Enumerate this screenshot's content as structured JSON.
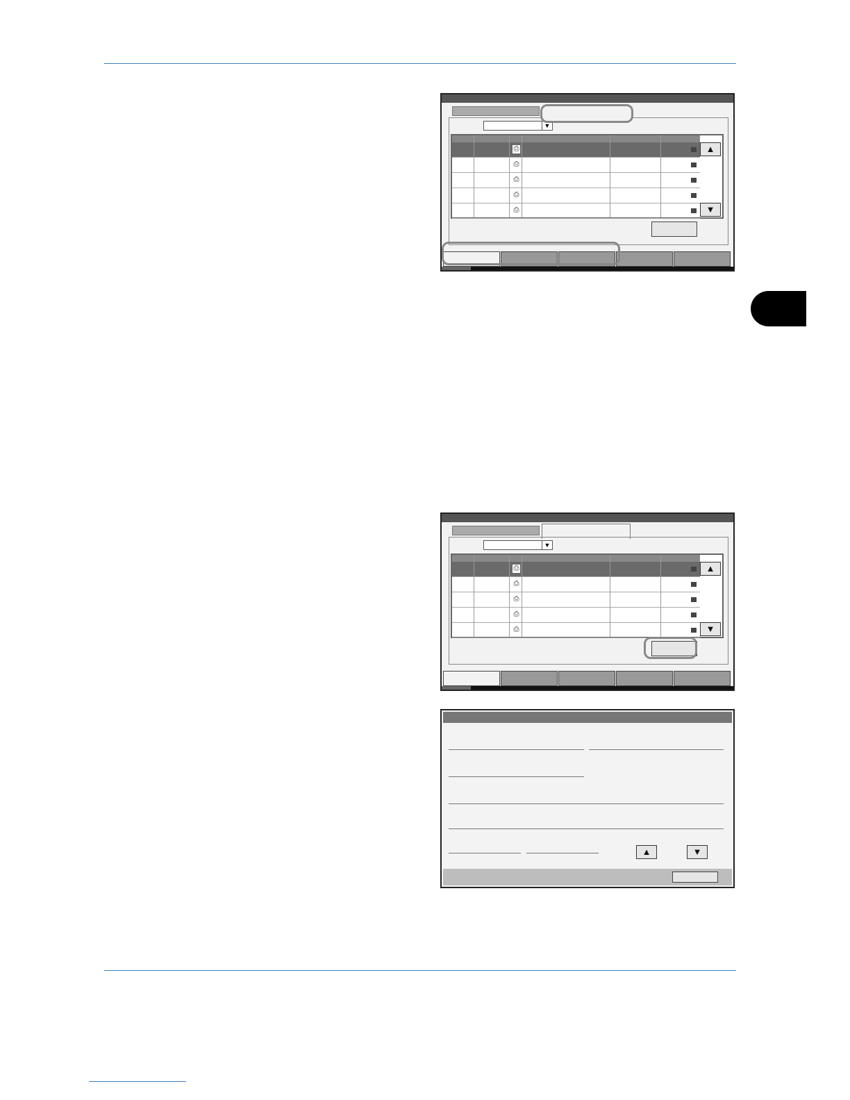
{
  "icons": {
    "scroll_up": "up-triangle",
    "scroll_down": "down-triangle",
    "dropdown": "down-triangle",
    "row_job": "printer-icon",
    "row_status": "status-icon"
  },
  "glyphs": {
    "up": "▲",
    "down": "▼",
    "row_icon": "⎙"
  },
  "colors": {
    "rule": "#3a7fbf",
    "chapter_tab": "#000000",
    "highlight": "#888888"
  }
}
